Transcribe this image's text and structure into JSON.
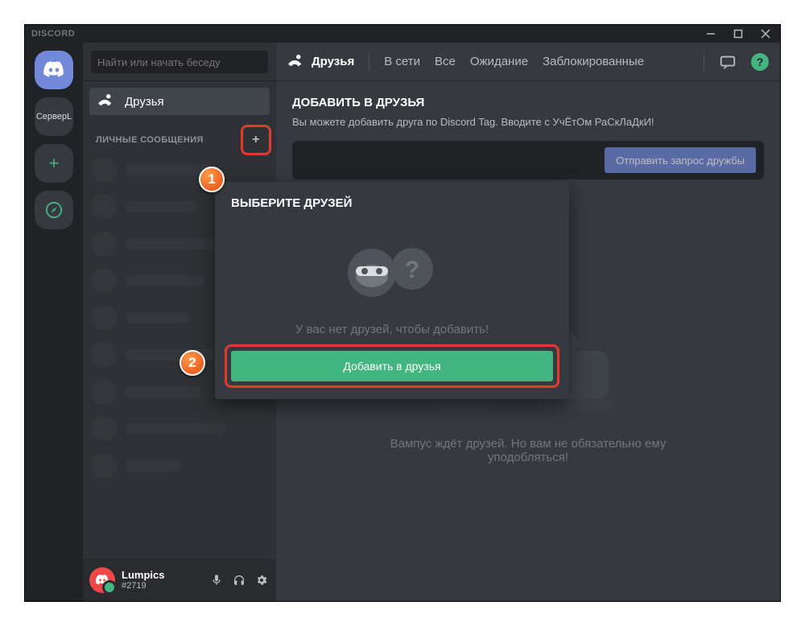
{
  "titlebar": {
    "app_name": "DISCORD"
  },
  "servers": {
    "label_server1": "СерверL"
  },
  "dm": {
    "search_placeholder": "Найти или начать беседу",
    "friends_label": "Друзья",
    "section_header": "ЛИЧНЫЕ СООБЩЕНИЯ"
  },
  "user": {
    "name": "Lumpics",
    "tag": "#2719"
  },
  "header": {
    "tab_friends": "Друзья",
    "tab_online": "В сети",
    "tab_all": "Все",
    "tab_pending": "Ожидание",
    "tab_blocked": "Заблокированные"
  },
  "add_friend": {
    "title": "ДОБАВИТЬ В ДРУЗЬЯ",
    "desc": "Вы можете добавить друга по Discord Tag. Вводите с УчЁтОм РаСкЛаДкИ!",
    "button": "Отправить запрос дружбы"
  },
  "empty_main": {
    "line1": "Вампус ждёт друзей. Но вам не обязательно ему",
    "line2": "уподобляться!"
  },
  "popover": {
    "title": "ВЫБЕРИТЕ ДРУЗЕЙ",
    "empty": "У вас нет друзей, чтобы добавить!",
    "button": "Добавить в друзья"
  },
  "markers": {
    "one": "1",
    "two": "2"
  }
}
